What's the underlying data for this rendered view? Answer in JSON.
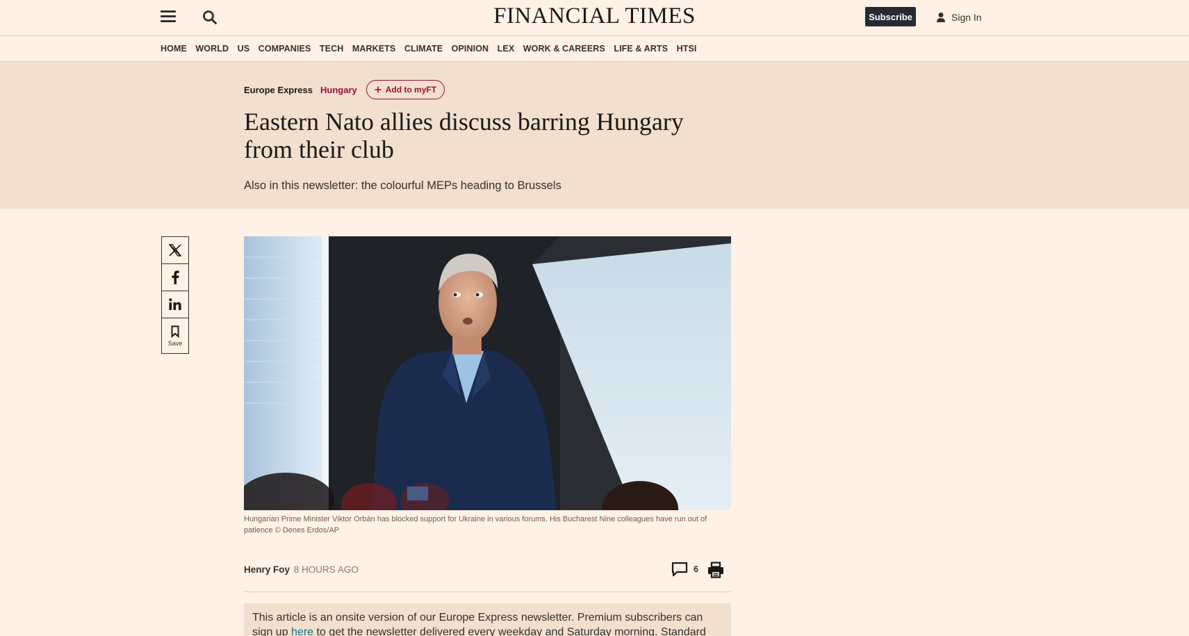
{
  "header": {
    "logo": "FINANCIAL TIMES",
    "subscribe_label": "Subscribe",
    "signin_label": "Sign In"
  },
  "nav": {
    "items": [
      "HOME",
      "WORLD",
      "US",
      "COMPANIES",
      "TECH",
      "MARKETS",
      "CLIMATE",
      "OPINION",
      "LEX",
      "WORK & CAREERS",
      "LIFE & ARTS",
      "HTSI"
    ]
  },
  "article": {
    "series": "Europe Express",
    "topic": "Hungary",
    "myft_label": "Add to myFT",
    "headline": "Eastern Nato allies discuss barring Hungary from their club",
    "standfirst": "Also in this newsletter: the colourful MEPs heading to Brussels",
    "caption": "Hungarian Prime Minister Viktor Orbán has blocked support for Ukraine in various forums. His Bucharest Nine colleagues have run out of patience © Denes Erdos/AP",
    "author": "Henry Foy",
    "time": "8 HOURS AGO",
    "comment_count": "6",
    "notice_part1": "This article is an onsite version of our Europe Express newsletter. Premium subscribers can sign up ",
    "notice_link": "here",
    "notice_part2": " to get the newsletter delivered every weekday and Saturday morning. Standard"
  },
  "share": {
    "save_label": "Save"
  },
  "colors": {
    "page_bg": "#fff1e5",
    "hero_bg": "#f2dfce",
    "accent": "#990f3d",
    "subscribe_bg": "#262a33",
    "link": "#0d7680"
  },
  "icons": [
    "menu-icon",
    "search-icon",
    "user-icon",
    "x-icon",
    "facebook-icon",
    "linkedin-icon",
    "bookmark-icon",
    "comment-icon",
    "print-icon",
    "plus-icon"
  ]
}
